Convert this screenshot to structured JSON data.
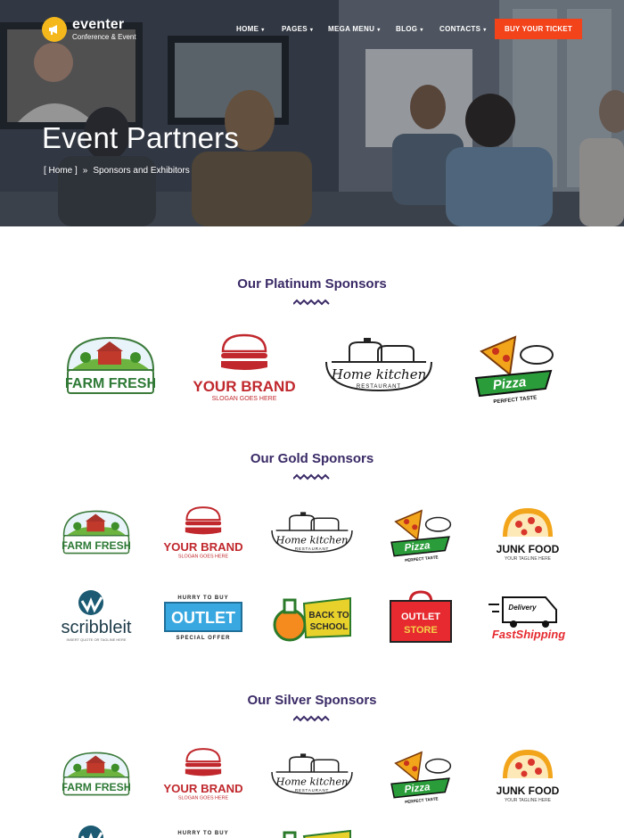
{
  "brand": {
    "name": "eventer",
    "tagline": "Conference & Event"
  },
  "nav": {
    "items": [
      {
        "label": "HOME",
        "caret": "▾"
      },
      {
        "label": "PAGES",
        "caret": "▾"
      },
      {
        "label": "MEGA MENU",
        "caret": "▾"
      },
      {
        "label": "BLOG",
        "caret": "▾"
      },
      {
        "label": "CONTACTS",
        "caret": "▾"
      }
    ],
    "cta": "BUY YOUR TICKET"
  },
  "hero": {
    "title": "Event Partners",
    "breadcrumb": {
      "home": "[ Home ]",
      "separator": "»",
      "current": "Sponsors and Exhibitors"
    }
  },
  "sections": {
    "platinum": "Our Platinum Sponsors",
    "gold": "Our Gold Sponsors",
    "silver": "Our Silver Sponsors"
  },
  "logos": {
    "farm": {
      "text": "FARM FRESH"
    },
    "brand": {
      "text": "YOUR BRAND",
      "slogan": "SLOGAN GOES HERE"
    },
    "kitchen": {
      "text": "Home kitchen",
      "sub": "RESTAURANT"
    },
    "pizza": {
      "text": "Pizza",
      "sub": "PERFECT TASTE"
    },
    "junk": {
      "text": "JUNK FOOD",
      "sub": "YOUR TAGLINE HERE"
    },
    "scribble": {
      "text": "scribbleit",
      "sub": "INSERT QUOTE OR TAGLINE HERE"
    },
    "outlet": {
      "top": "HURRY TO BUY",
      "text": "OUTLET",
      "sub": "SPECIAL OFFER"
    },
    "school": {
      "line1": "BACK TO",
      "line2": "SCHOOL"
    },
    "store": {
      "line1": "OUTLET",
      "line2": "STORE"
    },
    "shipping": {
      "badge": "Delivery",
      "text": "FastShipping"
    }
  },
  "colors": {
    "accent": "#f2431b",
    "heading": "#3a2a66",
    "logo_mark": "#f5b81c"
  }
}
